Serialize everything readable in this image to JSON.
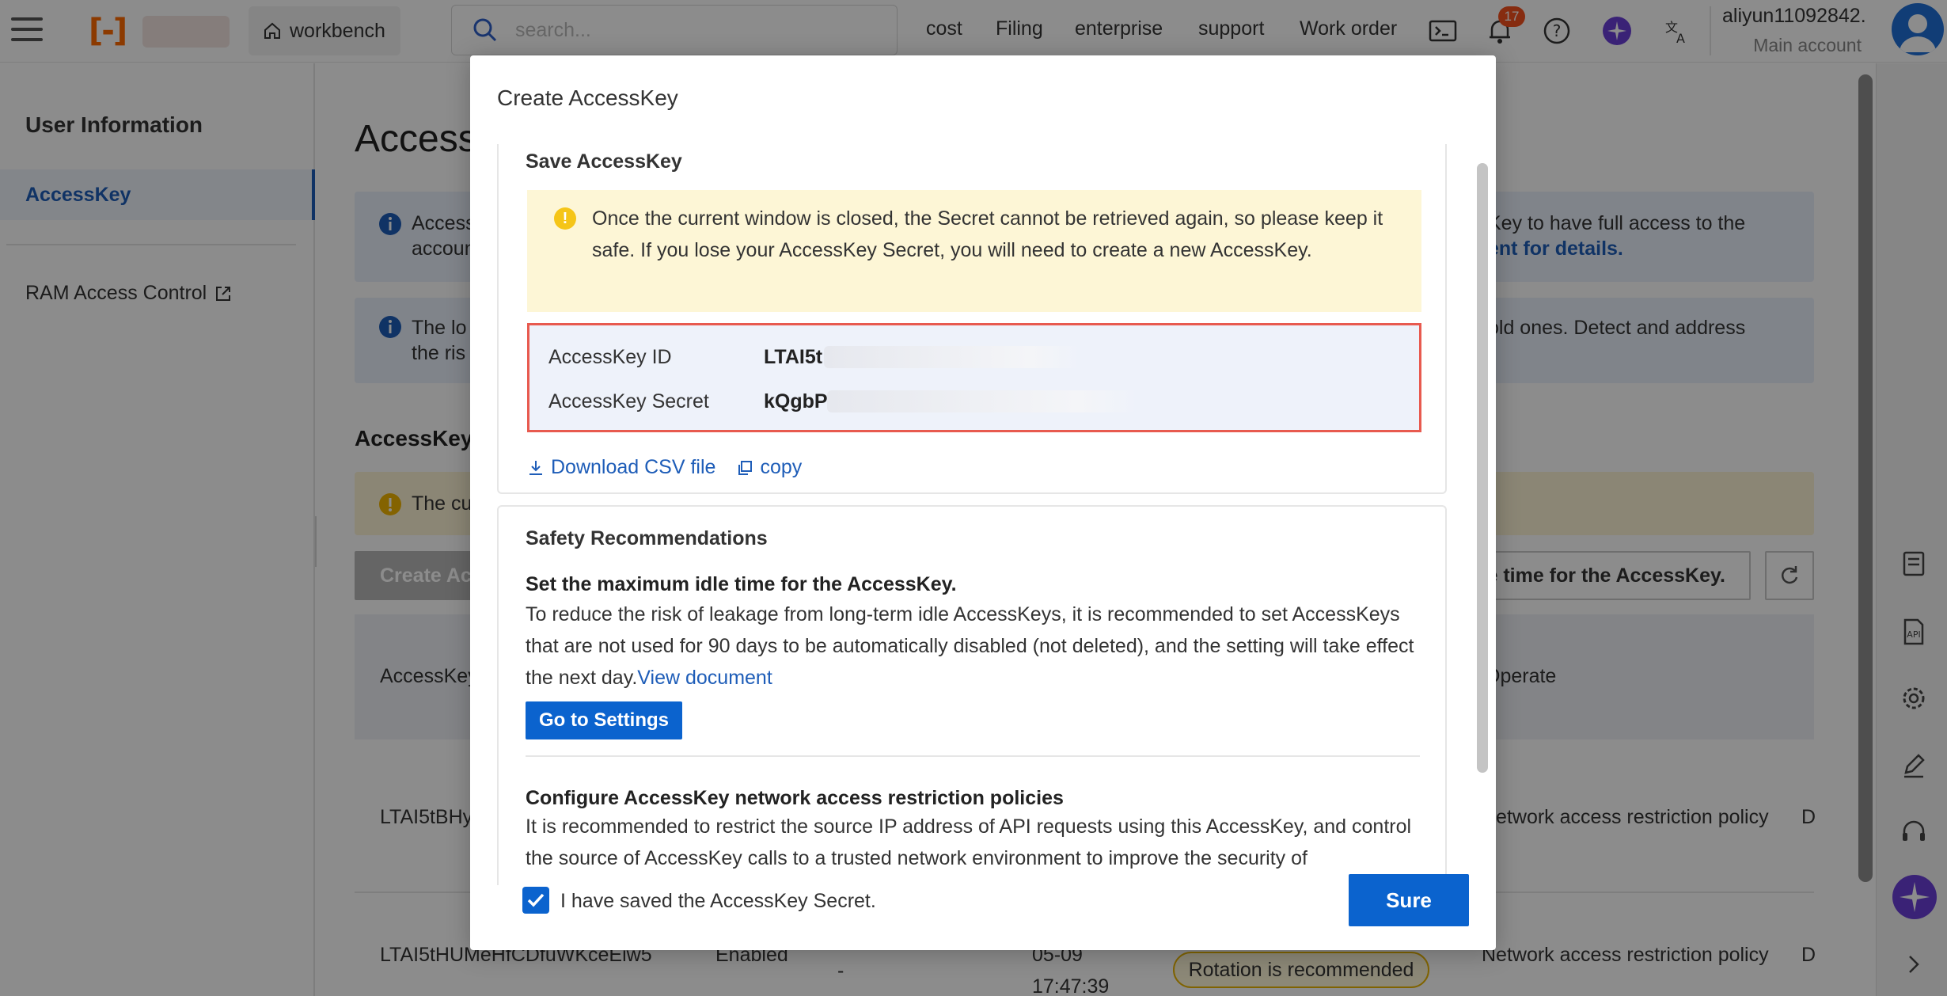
{
  "topbar": {
    "workbench_label": "workbench",
    "search_placeholder": "search...",
    "nav": [
      "cost",
      "Filing",
      "enterprise",
      "support",
      "Work order"
    ],
    "notification_count": "17",
    "account_name": "aliyun11092842...",
    "account_type": "Main account",
    "brand_color": "#ff6a00"
  },
  "sidebar": {
    "title": "User Information",
    "active_item": "AccessKey",
    "ram_item": "RAM Access Control"
  },
  "background": {
    "page_title": "Access",
    "info1_line1": "Access",
    "info1_line2": "accoun",
    "info1_right_line1": "Key to have full access to the",
    "info1_right_line2": "ent for details.",
    "info2_line1": "The lo",
    "info2_line2": "the ris",
    "info2_right": "old ones. Detect and address",
    "section_title": "AccessKey",
    "warn_text": "The cu",
    "create_btn": "Create Ac",
    "idle_btn": "e time for the AccessKey.",
    "table_header_first": "AccessKey",
    "table_header_op": "Operate",
    "row1_id": "LTAI5tBHy",
    "row1_policy": "Network access restriction policy",
    "row1_more": "D",
    "row2_id": "LTAI5tHUMeHfCDfuWKceEiw5",
    "row2_status": "Enabled",
    "row2_dash": "-",
    "row2_date": "05-09",
    "row2_time": "17:47:39",
    "row2_badge": "Rotation is recommended",
    "row2_policy": "Network access restriction policy",
    "row2_more": "D"
  },
  "modal": {
    "title": "Create AccessKey",
    "save_section_title": "Save AccessKey",
    "notice": "Once the current window is closed, the Secret cannot be retrieved again, so please keep it safe. If you lose your AccessKey Secret, you will need to create a new AccessKey.",
    "id_label": "AccessKey ID",
    "id_value": "LTAI5t",
    "secret_label": "AccessKey Secret",
    "secret_value": "kQgbP",
    "download_label": "Download CSV file",
    "copy_label": "copy",
    "safety_title": "Safety Recommendations",
    "rec1_title": "Set the maximum idle time for the AccessKey.",
    "rec1_text": "To reduce the risk of leakage from long-term idle AccessKeys, it is recommended to set AccessKeys that are not used for 90 days to be automatically disabled (not deleted), and the setting will take effect the next day.",
    "rec1_link": "View document",
    "go_settings": "Go to Settings",
    "rec2_title": "Configure AccessKey network access restriction policies",
    "rec2_text": "It is recommended to restrict the source IP address of API requests using this AccessKey, and control the source of AccessKey calls to a trusted network environment to improve the security of",
    "checkbox_label": "I have saved the AccessKey Secret.",
    "checkbox_checked": true,
    "sure_button": "Sure"
  }
}
